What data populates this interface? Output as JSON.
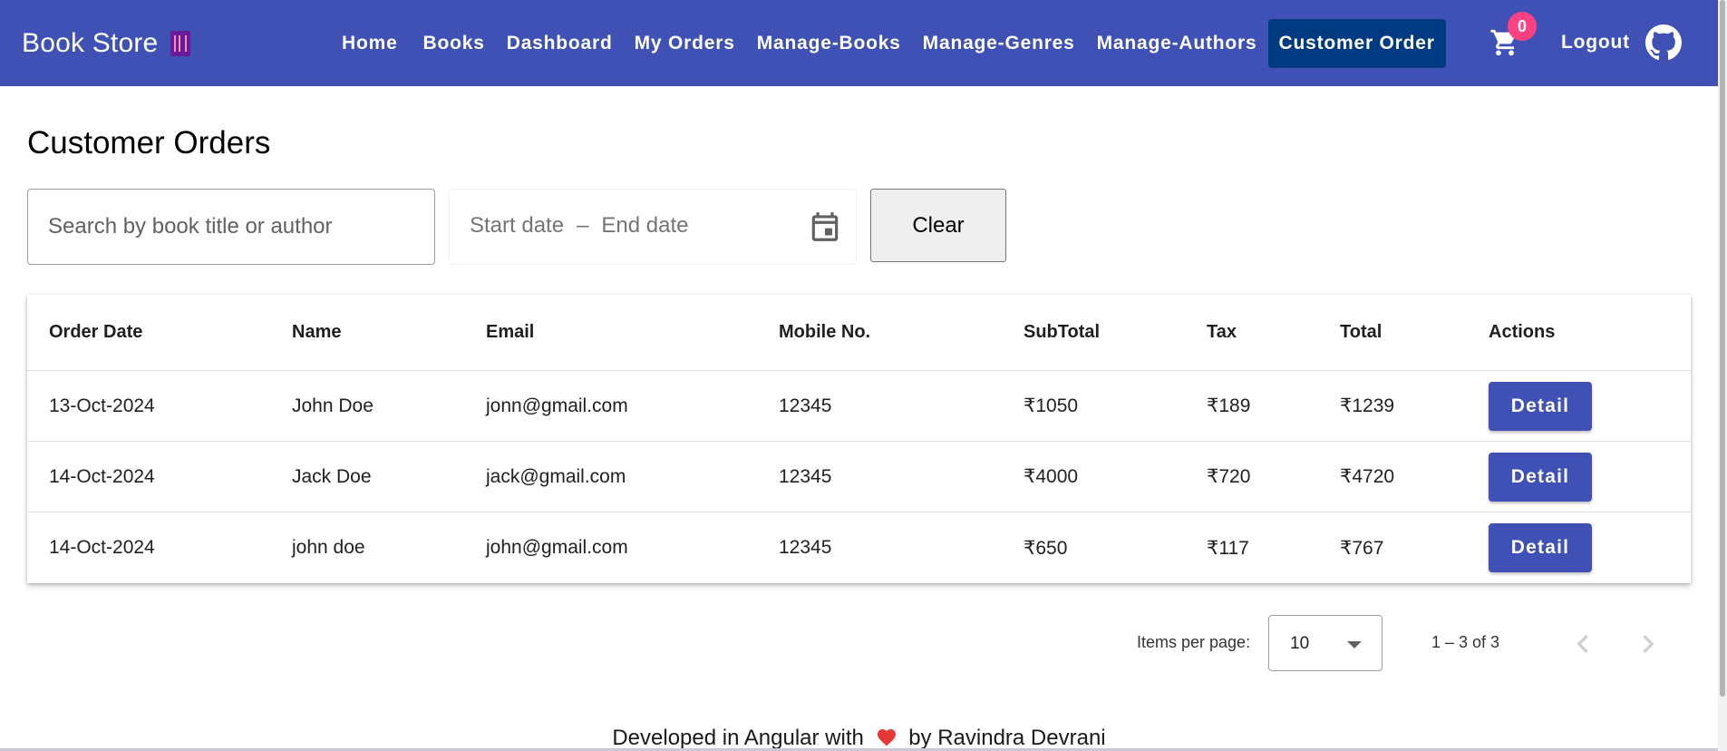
{
  "app": {
    "brand_title": "Book Store",
    "brand_icon": "books-icon"
  },
  "nav": {
    "items": [
      {
        "label": "Home"
      },
      {
        "label": "Books"
      },
      {
        "label": "Dashboard"
      },
      {
        "label": "My Orders"
      },
      {
        "label": "Manage-Books"
      },
      {
        "label": "Manage-Genres"
      },
      {
        "label": "Manage-Authors"
      },
      {
        "label": "Customer Order",
        "active": true
      }
    ],
    "cart_count": "0",
    "logout_label": "Logout"
  },
  "page": {
    "title": "Customer Orders"
  },
  "filters": {
    "search_placeholder": "Search by book title or author",
    "search_value": "",
    "start_date_placeholder": "Start date",
    "separator": "–",
    "end_date_placeholder": "End date",
    "clear_label": "Clear"
  },
  "table": {
    "columns": [
      "Order Date",
      "Name",
      "Email",
      "Mobile No.",
      "SubTotal",
      "Tax",
      "Total",
      "Actions"
    ],
    "rows": [
      {
        "date": "13-Oct-2024",
        "name": "John Doe",
        "email": "jonn@gmail.com",
        "mobile": "12345",
        "subtotal": "₹1050",
        "tax": "₹189",
        "total": "₹1239",
        "action": "Detail"
      },
      {
        "date": "14-Oct-2024",
        "name": "Jack Doe",
        "email": "jack@gmail.com",
        "mobile": "12345",
        "subtotal": "₹4000",
        "tax": "₹720",
        "total": "₹4720",
        "action": "Detail"
      },
      {
        "date": "14-Oct-2024",
        "name": "john doe",
        "email": "john@gmail.com",
        "mobile": "12345",
        "subtotal": "₹650",
        "tax": "₹117",
        "total": "₹767",
        "action": "Detail"
      }
    ]
  },
  "paginator": {
    "items_per_page_label": "Items per page:",
    "page_size": "10",
    "range_label": "1 – 3 of 3"
  },
  "footer": {
    "text_before": "Developed in Angular with",
    "text_after": "by Ravindra Devrani"
  },
  "colors": {
    "primary": "#3f51b5",
    "active_nav": "#003a80",
    "badge": "#ff4081"
  }
}
